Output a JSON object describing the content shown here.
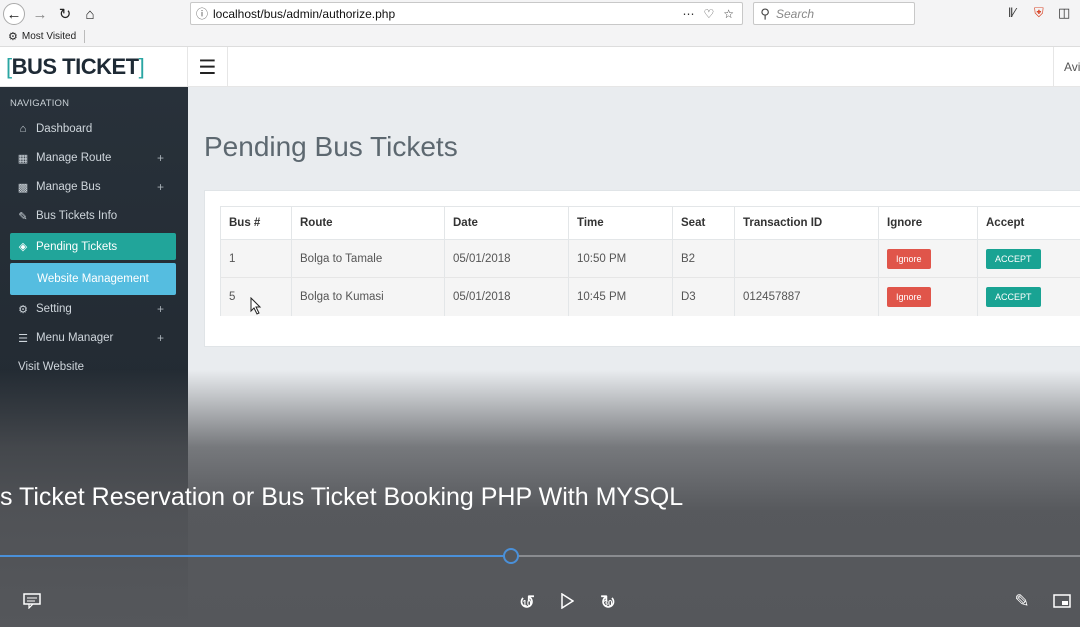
{
  "browser": {
    "url": "localhost/bus/admin/authorize.php",
    "search_placeholder": "Search",
    "bookmark_label": "Most Visited"
  },
  "header": {
    "logo_open": "[",
    "logo_text": "BUS TICKET",
    "logo_close": "]",
    "user_partial": "Avi"
  },
  "sidebar": {
    "heading": "NAVIGATION",
    "items": [
      {
        "label": "Dashboard",
        "icon": "home-icon"
      },
      {
        "label": "Manage Route",
        "icon": "table-icon"
      },
      {
        "label": "Manage Bus",
        "icon": "bar-chart-icon"
      },
      {
        "label": "Bus Tickets Info",
        "icon": "edit-icon"
      },
      {
        "label": "Pending Tickets",
        "icon": "ticket-icon"
      },
      {
        "label": "Website Management",
        "icon": ""
      },
      {
        "label": "Setting",
        "icon": "gear-icon"
      },
      {
        "label": "Menu Manager",
        "icon": "list-icon"
      },
      {
        "label": "Visit Website",
        "icon": ""
      }
    ]
  },
  "main": {
    "title": "Pending Bus Tickets",
    "columns": [
      "Bus #",
      "Route",
      "Date",
      "Time",
      "Seat",
      "Transaction ID",
      "Ignore",
      "Accept"
    ],
    "rows": [
      {
        "bus": "1",
        "route": "Bolga to Tamale",
        "date": "05/01/2018",
        "time": "10:50 PM",
        "seat": "B2",
        "transaction": "",
        "ignore": "Ignore",
        "accept": "ACCEPT"
      },
      {
        "bus": "5",
        "route": "Bolga to Kumasi",
        "date": "05/01/2018",
        "time": "10:45 PM",
        "seat": "D3",
        "transaction": "012457887",
        "ignore": "Ignore",
        "accept": "ACCEPT"
      }
    ]
  },
  "video": {
    "caption": "s Ticket Reservation or Bus Ticket Booking PHP With MYSQL",
    "progress_fraction": 0.473,
    "skip_back_label": "10",
    "skip_forward_label": "30"
  },
  "colors": {
    "accent_teal": "#21a59a",
    "web_mgmt_blue": "#55bde0",
    "ignore_red": "#e0554a",
    "accept_teal": "#19a393",
    "progress_blue": "#4a90d9"
  }
}
